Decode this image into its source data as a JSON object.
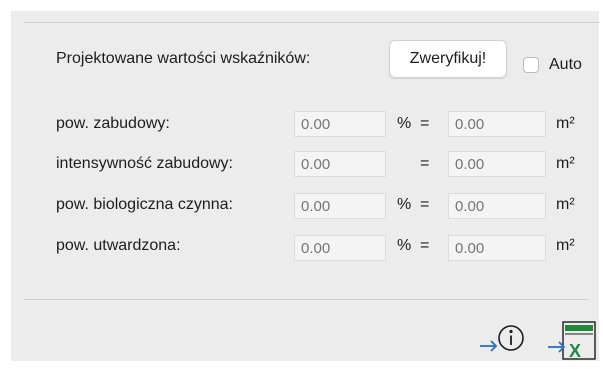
{
  "header": {
    "title": "Projektowane wartości wskaźników:",
    "verify_label": "Zweryfikuj!",
    "auto_label": "Auto",
    "auto_checked": false
  },
  "rows": [
    {
      "label": "pow. zabudowy:",
      "value": "0.00",
      "percent_sign": "%",
      "equals": "=",
      "area_value": "0.00",
      "unit": "m²"
    },
    {
      "label": "intensywność zabudowy:",
      "value": "0.00",
      "percent_sign": "",
      "equals": "=",
      "area_value": "0.00",
      "unit": "m²"
    },
    {
      "label": "pow. biologiczna czynna:",
      "value": "0.00",
      "percent_sign": "%",
      "equals": "=",
      "area_value": "0.00",
      "unit": "m²"
    },
    {
      "label": "pow. utwardzona:",
      "value": "0.00",
      "percent_sign": "%",
      "equals": "=",
      "area_value": "0.00",
      "unit": "m²"
    }
  ],
  "footer": {
    "info_icon": "arrow-info-icon",
    "export_icon": "arrow-excel-export-icon",
    "excel_letter": "X"
  },
  "colors": {
    "arrow": "#2a6fc9",
    "excel_green": "#1f8a3c",
    "panel": "#ececec"
  }
}
